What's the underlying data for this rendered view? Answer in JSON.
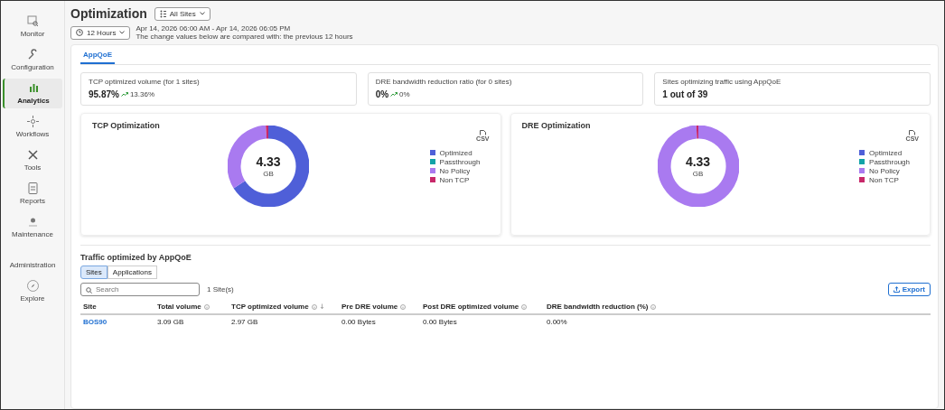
{
  "sidebar": {
    "items": [
      {
        "label": "Monitor",
        "kind": "icon",
        "selected": false
      },
      {
        "label": "Configuration",
        "kind": "icon",
        "selected": false
      },
      {
        "label": "Analytics",
        "kind": "icon",
        "selected": true
      },
      {
        "label": "Workflows",
        "kind": "icon",
        "selected": false
      },
      {
        "label": "Tools",
        "kind": "icon",
        "selected": false
      },
      {
        "label": "Reports",
        "kind": "icon",
        "selected": false
      },
      {
        "label": "Maintenance",
        "kind": "icon",
        "selected": false
      },
      {
        "label": "Administration",
        "kind": "text",
        "selected": false
      },
      {
        "label": "Explore",
        "kind": "icon",
        "selected": false
      }
    ]
  },
  "header": {
    "title": "Optimization",
    "site_filter": "All Sites",
    "time_range": "12 Hours",
    "date_range": "Apr 14, 2026 06:00 AM - Apr 14, 2026 06:05 PM",
    "comparison_note": "The change values below are compared with: the previous 12 hours"
  },
  "tabs": [
    {
      "label": "AppQoE",
      "selected": true
    }
  ],
  "kpis": [
    {
      "label": "TCP optimized volume (for 1 sites)",
      "value": "95.87%",
      "change": "13.36%"
    },
    {
      "label": "DRE bandwidth reduction ratio (for 0 sites)",
      "value": "0%",
      "change": "0%"
    },
    {
      "label": "Sites optimizing traffic using AppQoE",
      "value": "1 out of 39"
    }
  ],
  "charts": [
    {
      "title": "TCP Optimization",
      "total": "4.33",
      "unit": "GB",
      "export": "CSV",
      "legend": [
        {
          "label": "Optimized",
          "color": "#4f5fd8"
        },
        {
          "label": "Passthrough",
          "color": "#12a3a8"
        },
        {
          "label": "No Policy",
          "color": "#a97af0"
        },
        {
          "label": "Non TCP",
          "color": "#c8286a"
        }
      ]
    },
    {
      "title": "DRE Optimization",
      "total": "4.33",
      "unit": "GB",
      "export": "CSV",
      "legend": [
        {
          "label": "Optimized",
          "color": "#4f5fd8"
        },
        {
          "label": "Passthrough",
          "color": "#12a3a8"
        },
        {
          "label": "No Policy",
          "color": "#a97af0"
        },
        {
          "label": "Non TCP",
          "color": "#c8286a"
        }
      ]
    }
  ],
  "traffic": {
    "title": "Traffic optimized by AppQoE",
    "views": [
      {
        "label": "Sites",
        "selected": true
      },
      {
        "label": "Applications",
        "selected": false
      }
    ],
    "search": {
      "placeholder": "Search"
    },
    "count": "1 Site(s)",
    "export": "Export",
    "table": {
      "columns": [
        {
          "label": "Site",
          "kind": "plain"
        },
        {
          "label": "Total volume",
          "kind": "info"
        },
        {
          "label": "TCP optimized volume",
          "kind": "sortable"
        },
        {
          "label": "Pre DRE volume",
          "kind": "info"
        },
        {
          "label": "Post DRE optimized volume",
          "kind": "info"
        },
        {
          "label": "DRE bandwidth reduction (%)",
          "kind": "info"
        }
      ],
      "rows": [
        [
          "BOS90",
          "3.09 GB",
          "2.97 GB",
          "0.00 Bytes",
          "0.00 Bytes",
          "0.00%"
        ]
      ]
    }
  }
}
